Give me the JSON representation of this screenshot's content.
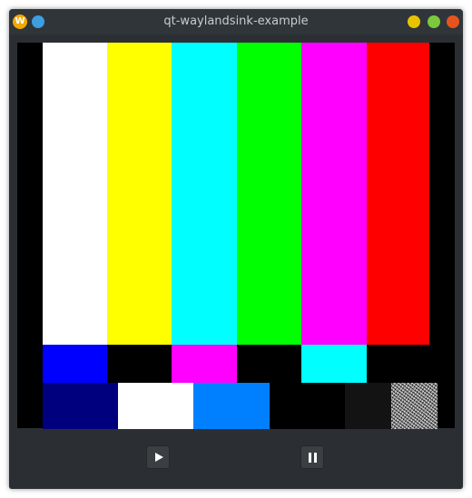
{
  "window": {
    "title": "qt-waylandsink-example",
    "app_icon_letter": "W",
    "app_icon": "app-logo-icon",
    "buttons": [
      "pin-icon",
      "minimize-icon",
      "maximize-icon",
      "close-icon"
    ]
  },
  "video": {
    "pattern": "smpte-color-bars",
    "top_bars": [
      "#ffffff",
      "#ffff00",
      "#00ffff",
      "#00ff00",
      "#ff00ff",
      "#ff0000"
    ],
    "middle_bars": [
      "#0000ff",
      "#000000",
      "#ff00ff",
      "#000000",
      "#00ffff",
      "#000000"
    ],
    "bottom_blocks": [
      "#00007f",
      "#ffffff",
      "#0080ff",
      "#000000",
      "#131313",
      "noise"
    ]
  },
  "controls": {
    "play_icon": "play-icon",
    "pause_icon": "pause-icon"
  },
  "colors": {
    "window_bg": "#2b2f33",
    "titlebar_bg": "#30353a",
    "button_bg": "#3a3f44"
  }
}
